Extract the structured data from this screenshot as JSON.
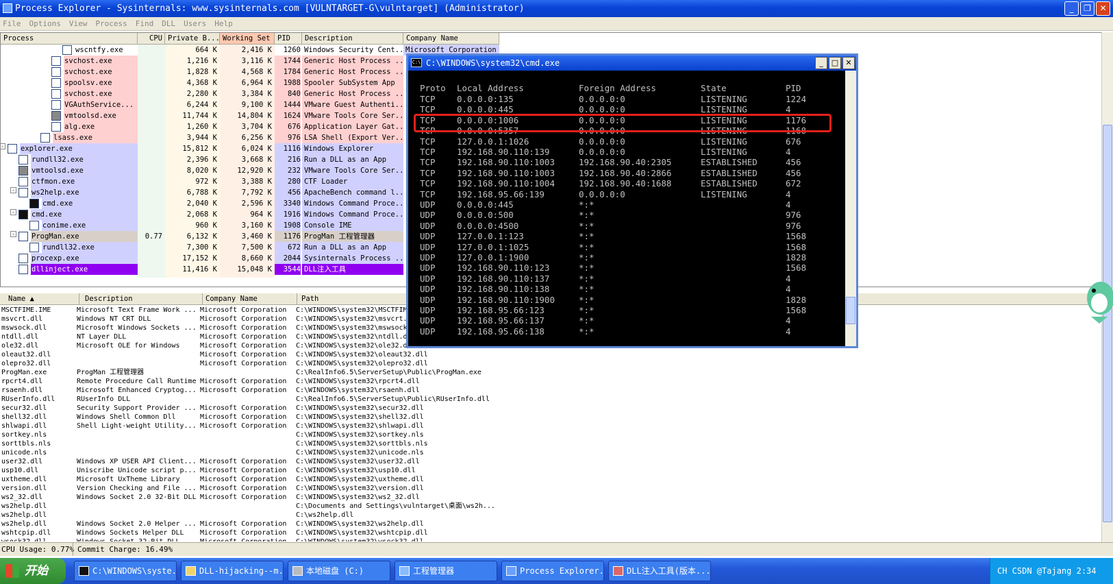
{
  "window": {
    "title": "Process Explorer - Sysinternals: www.sysinternals.com [VULNTARGET-G\\vulntarget] (Administrator)",
    "btn_min": "_",
    "btn_max": "❐",
    "btn_close": "✕"
  },
  "menu": [
    "File",
    "Options",
    "View",
    "Process",
    "Find",
    "DLL",
    "Users",
    "Help"
  ],
  "process_columns": [
    "Process",
    "CPU",
    "Private B...",
    "Working Set",
    "PID",
    "Description",
    "Company Name"
  ],
  "processes": [
    {
      "indent": 5,
      "icon": "window",
      "name": "wscntfy.exe",
      "cpu": "",
      "priv": "664 K",
      "ws": "2,416 K",
      "pid": "1260",
      "desc": "Windows Security Cent...",
      "company": "Microsoft Corporation",
      "row": "plain"
    },
    {
      "indent": 4,
      "icon": "window",
      "name": "svchost.exe",
      "cpu": "",
      "priv": "1,216 K",
      "ws": "3,116 K",
      "pid": "1744",
      "desc": "Generic Host Process ...",
      "company": "",
      "row": "pink"
    },
    {
      "indent": 4,
      "icon": "window",
      "name": "svchost.exe",
      "cpu": "",
      "priv": "1,828 K",
      "ws": "4,568 K",
      "pid": "1784",
      "desc": "Generic Host Process ...",
      "company": "",
      "row": "pink"
    },
    {
      "indent": 4,
      "icon": "window",
      "name": "spoolsv.exe",
      "cpu": "",
      "priv": "4,368 K",
      "ws": "6,964 K",
      "pid": "1988",
      "desc": "Spooler SubSystem App",
      "company": "",
      "row": "pink"
    },
    {
      "indent": 4,
      "icon": "window",
      "name": "svchost.exe",
      "cpu": "",
      "priv": "2,280 K",
      "ws": "3,384 K",
      "pid": "840",
      "desc": "Generic Host Process ...",
      "company": "",
      "row": "pink"
    },
    {
      "indent": 4,
      "icon": "window",
      "name": "VGAuthService...",
      "cpu": "",
      "priv": "6,244 K",
      "ws": "9,100 K",
      "pid": "1444",
      "desc": "VMware Guest Authenti...",
      "company": "",
      "row": "pink"
    },
    {
      "indent": 4,
      "icon": "vm",
      "name": "vmtoolsd.exe",
      "cpu": "",
      "priv": "11,744 K",
      "ws": "14,804 K",
      "pid": "1624",
      "desc": "VMware Tools Core Ser...",
      "company": "",
      "row": "pink"
    },
    {
      "indent": 4,
      "icon": "window",
      "name": "alg.exe",
      "cpu": "",
      "priv": "1,260 K",
      "ws": "3,704 K",
      "pid": "676",
      "desc": "Application Layer Gat...",
      "company": "",
      "row": "pink"
    },
    {
      "indent": 3,
      "icon": "window",
      "name": "lsass.exe",
      "cpu": "",
      "priv": "3,944 K",
      "ws": "6,256 K",
      "pid": "976",
      "desc": "LSA Shell (Export Ver...",
      "company": "",
      "row": "pink"
    },
    {
      "indent": 0,
      "icon": "explorer",
      "name": "explorer.exe",
      "cpu": "",
      "priv": "15,812 K",
      "ws": "6,024 K",
      "pid": "1116",
      "desc": "Windows Explorer",
      "company": "",
      "row": "blue",
      "tree": "-"
    },
    {
      "indent": 1,
      "icon": "window",
      "name": "rundll32.exe",
      "cpu": "",
      "priv": "2,396 K",
      "ws": "3,668 K",
      "pid": "216",
      "desc": "Run a DLL as an App",
      "company": "",
      "row": "blue"
    },
    {
      "indent": 1,
      "icon": "vm",
      "name": "vmtoolsd.exe",
      "cpu": "",
      "priv": "8,020 K",
      "ws": "12,920 K",
      "pid": "232",
      "desc": "VMware Tools Core Ser...",
      "company": "",
      "row": "blue"
    },
    {
      "indent": 1,
      "icon": "window",
      "name": "ctfmon.exe",
      "cpu": "",
      "priv": "972 K",
      "ws": "3,388 K",
      "pid": "280",
      "desc": "CTF Loader",
      "company": "",
      "row": "blue"
    },
    {
      "indent": 1,
      "icon": "window",
      "name": "ws2help.exe",
      "cpu": "",
      "priv": "6,788 K",
      "ws": "7,792 K",
      "pid": "456",
      "desc": "ApacheBench command l...",
      "company": "",
      "row": "blue",
      "tree": "-"
    },
    {
      "indent": 2,
      "icon": "cmd",
      "name": "cmd.exe",
      "cpu": "",
      "priv": "2,040 K",
      "ws": "2,596 K",
      "pid": "3340",
      "desc": "Windows Command Proce...",
      "company": "",
      "row": "blue"
    },
    {
      "indent": 1,
      "icon": "cmd",
      "name": "cmd.exe",
      "cpu": "",
      "priv": "2,068 K",
      "ws": "964 K",
      "pid": "1916",
      "desc": "Windows Command Proce...",
      "company": "",
      "row": "blue",
      "tree": "-"
    },
    {
      "indent": 2,
      "icon": "window",
      "name": "conime.exe",
      "cpu": "",
      "priv": "960 K",
      "ws": "3,160 K",
      "pid": "1908",
      "desc": "Console IME",
      "company": "",
      "row": "blue"
    },
    {
      "indent": 1,
      "icon": "window",
      "name": "ProgMan.exe",
      "cpu": "0.77",
      "priv": "6,132 K",
      "ws": "3,460 K",
      "pid": "1176",
      "desc": "ProgMan 工程管理器",
      "company": "",
      "row": "gray",
      "tree": "-"
    },
    {
      "indent": 2,
      "icon": "window",
      "name": "rundll32.exe",
      "cpu": "",
      "priv": "7,300 K",
      "ws": "7,500 K",
      "pid": "672",
      "desc": "Run a DLL as an App",
      "company": "",
      "row": "blue"
    },
    {
      "indent": 1,
      "icon": "window",
      "name": "procexp.exe",
      "cpu": "",
      "priv": "17,152 K",
      "ws": "8,660 K",
      "pid": "2044",
      "desc": "Sysinternals Process ...",
      "company": "",
      "row": "blue"
    },
    {
      "indent": 1,
      "icon": "window",
      "name": "dllinject.exe",
      "cpu": "",
      "priv": "11,416 K",
      "ws": "15,048 K",
      "pid": "3544",
      "desc": "DLL注入工具",
      "company": "",
      "row": "purple"
    }
  ],
  "dll_columns": [
    "Name",
    "Description",
    "Company Name",
    "Path"
  ],
  "dlls": [
    {
      "name": "MSCTFIME.IME",
      "desc": "Microsoft Text Frame Work ...",
      "company": "Microsoft Corporation",
      "path": "C:\\WINDOWS\\system32\\MSCTFIME.IME"
    },
    {
      "name": "msvcrt.dll",
      "desc": "Windows NT CRT DLL",
      "company": "Microsoft Corporation",
      "path": "C:\\WINDOWS\\system32\\msvcrt.dll"
    },
    {
      "name": "mswsock.dll",
      "desc": "Microsoft Windows Sockets ...",
      "company": "Microsoft Corporation",
      "path": "C:\\WINDOWS\\system32\\mswsock.dll"
    },
    {
      "name": "ntdll.dll",
      "desc": "NT Layer DLL",
      "company": "Microsoft Corporation",
      "path": "C:\\WINDOWS\\system32\\ntdll.dll"
    },
    {
      "name": "ole32.dll",
      "desc": "Microsoft OLE for Windows",
      "company": "Microsoft Corporation",
      "path": "C:\\WINDOWS\\system32\\ole32.dll"
    },
    {
      "name": "oleaut32.dll",
      "desc": "",
      "company": "Microsoft Corporation",
      "path": "C:\\WINDOWS\\system32\\oleaut32.dll"
    },
    {
      "name": "olepro32.dll",
      "desc": "",
      "company": "Microsoft Corporation",
      "path": "C:\\WINDOWS\\system32\\olepro32.dll"
    },
    {
      "name": "ProgMan.exe",
      "desc": "ProgMan 工程管理器",
      "company": "",
      "path": "C:\\RealInfo6.5\\ServerSetup\\Public\\ProgMan.exe"
    },
    {
      "name": "rpcrt4.dll",
      "desc": "Remote Procedure Call Runtime",
      "company": "Microsoft Corporation",
      "path": "C:\\WINDOWS\\system32\\rpcrt4.dll"
    },
    {
      "name": "rsaenh.dll",
      "desc": "Microsoft Enhanced Cryptog...",
      "company": "Microsoft Corporation",
      "path": "C:\\WINDOWS\\system32\\rsaenh.dll"
    },
    {
      "name": "RUserInfo.dll",
      "desc": "RUserInfo DLL",
      "company": "",
      "path": "C:\\RealInfo6.5\\ServerSetup\\Public\\RUserInfo.dll"
    },
    {
      "name": "secur32.dll",
      "desc": "Security Support Provider ...",
      "company": "Microsoft Corporation",
      "path": "C:\\WINDOWS\\system32\\secur32.dll"
    },
    {
      "name": "shell32.dll",
      "desc": "Windows Shell Common Dll",
      "company": "Microsoft Corporation",
      "path": "C:\\WINDOWS\\system32\\shell32.dll"
    },
    {
      "name": "shlwapi.dll",
      "desc": "Shell Light-weight Utility...",
      "company": "Microsoft Corporation",
      "path": "C:\\WINDOWS\\system32\\shlwapi.dll"
    },
    {
      "name": "sortkey.nls",
      "desc": "",
      "company": "",
      "path": "C:\\WINDOWS\\system32\\sortkey.nls"
    },
    {
      "name": "sorttbls.nls",
      "desc": "",
      "company": "",
      "path": "C:\\WINDOWS\\system32\\sorttbls.nls"
    },
    {
      "name": "unicode.nls",
      "desc": "",
      "company": "",
      "path": "C:\\WINDOWS\\system32\\unicode.nls"
    },
    {
      "name": "user32.dll",
      "desc": "Windows XP USER API Client...",
      "company": "Microsoft Corporation",
      "path": "C:\\WINDOWS\\system32\\user32.dll"
    },
    {
      "name": "usp10.dll",
      "desc": "Uniscribe Unicode script p...",
      "company": "Microsoft Corporation",
      "path": "C:\\WINDOWS\\system32\\usp10.dll"
    },
    {
      "name": "uxtheme.dll",
      "desc": "Microsoft UxTheme Library",
      "company": "Microsoft Corporation",
      "path": "C:\\WINDOWS\\system32\\uxtheme.dll"
    },
    {
      "name": "version.dll",
      "desc": "Version Checking and File ...",
      "company": "Microsoft Corporation",
      "path": "C:\\WINDOWS\\system32\\version.dll"
    },
    {
      "name": "ws2_32.dll",
      "desc": "Windows Socket 2.0 32-Bit DLL",
      "company": "Microsoft Corporation",
      "path": "C:\\WINDOWS\\system32\\ws2_32.dll"
    },
    {
      "name": "ws2help.dll",
      "desc": "",
      "company": "",
      "path": "C:\\Documents and Settings\\vulntarget\\桌面\\ws2h..."
    },
    {
      "name": "ws2help.dll",
      "desc": "",
      "company": "",
      "path": "C:\\ws2help.dll"
    },
    {
      "name": "ws2help.dll",
      "desc": "Windows Socket 2.0 Helper ...",
      "company": "Microsoft Corporation",
      "path": "C:\\WINDOWS\\system32\\ws2help.dll"
    },
    {
      "name": "wshtcpip.dll",
      "desc": "Windows Sockets Helper DLL",
      "company": "Microsoft Corporation",
      "path": "C:\\WINDOWS\\system32\\wshtcpip.dll"
    },
    {
      "name": "wsock32.dll",
      "desc": "Windows Socket 32-Bit DLL",
      "company": "Microsoft Corporation",
      "path": "C:\\WINDOWS\\system32\\wsock32.dll"
    }
  ],
  "status": {
    "cpu": "CPU Usage: 0.77%",
    "commit": "Commit Charge: 16.49%"
  },
  "cmd": {
    "title": "C:\\WINDOWS\\system32\\cmd.exe",
    "icon_text": "C:\\",
    "headers": [
      "Proto",
      "Local Address",
      "Foreign Address",
      "State",
      "PID"
    ],
    "rows": [
      [
        "TCP",
        "0.0.0.0:135",
        "0.0.0.0:0",
        "LISTENING",
        "1224"
      ],
      [
        "TCP",
        "0.0.0.0:445",
        "0.0.0.0:0",
        "LISTENING",
        "4"
      ],
      [
        "TCP",
        "0.0.0.0:1006",
        "0.0.0.0:0",
        "LISTENING",
        "1176"
      ],
      [
        "TCP",
        "0.0.0.0:5357",
        "0.0.0.0:0",
        "LISTENING",
        "1168"
      ],
      [
        "TCP",
        "127.0.0.1:1026",
        "0.0.0.0:0",
        "LISTENING",
        "676"
      ],
      [
        "TCP",
        "192.168.90.110:139",
        "0.0.0.0:0",
        "LISTENING",
        "4"
      ],
      [
        "TCP",
        "192.168.90.110:1003",
        "192.168.90.40:2305",
        "ESTABLISHED",
        "456"
      ],
      [
        "TCP",
        "192.168.90.110:1003",
        "192.168.90.40:2866",
        "ESTABLISHED",
        "456"
      ],
      [
        "TCP",
        "192.168.90.110:1004",
        "192.168.90.40:1688",
        "ESTABLISHED",
        "672"
      ],
      [
        "TCP",
        "192.168.95.66:139",
        "0.0.0.0:0",
        "LISTENING",
        "4"
      ],
      [
        "UDP",
        "0.0.0.0:445",
        "*:*",
        "",
        "4"
      ],
      [
        "UDP",
        "0.0.0.0:500",
        "*:*",
        "",
        "976"
      ],
      [
        "UDP",
        "0.0.0.0:4500",
        "*:*",
        "",
        "976"
      ],
      [
        "UDP",
        "127.0.0.1:123",
        "*:*",
        "",
        "1568"
      ],
      [
        "UDP",
        "127.0.0.1:1025",
        "*:*",
        "",
        "1568"
      ],
      [
        "UDP",
        "127.0.0.1:1900",
        "*:*",
        "",
        "1828"
      ],
      [
        "UDP",
        "192.168.90.110:123",
        "*:*",
        "",
        "1568"
      ],
      [
        "UDP",
        "192.168.90.110:137",
        "*:*",
        "",
        "4"
      ],
      [
        "UDP",
        "192.168.90.110:138",
        "*:*",
        "",
        "4"
      ],
      [
        "UDP",
        "192.168.90.110:1900",
        "*:*",
        "",
        "1828"
      ],
      [
        "UDP",
        "192.168.95.66:123",
        "*:*",
        "",
        "1568"
      ],
      [
        "UDP",
        "192.168.95.66:137",
        "*:*",
        "",
        "4"
      ],
      [
        "UDP",
        "192.168.95.66:138",
        "*:*",
        "",
        "4"
      ]
    ],
    "highlight_row": 2
  },
  "taskbar": {
    "start": "开始",
    "tasks": [
      "C:\\WINDOWS\\syste...",
      "DLL-hijacking--m...",
      "本地磁盘 (C:)",
      "工程管理器",
      "Process Explorer...",
      "DLL注入工具(版本..."
    ],
    "tray": "CH  CSDN @Tajang  2:34"
  },
  "colors": {
    "pink": "#ffd0d0",
    "blue": "#d0d0ff",
    "purple": "#9000f0",
    "gray": "#d8d0c8",
    "cmd_bg": "#000000",
    "highlight": "#e8201a",
    "xp_blue": "#0843d6"
  }
}
